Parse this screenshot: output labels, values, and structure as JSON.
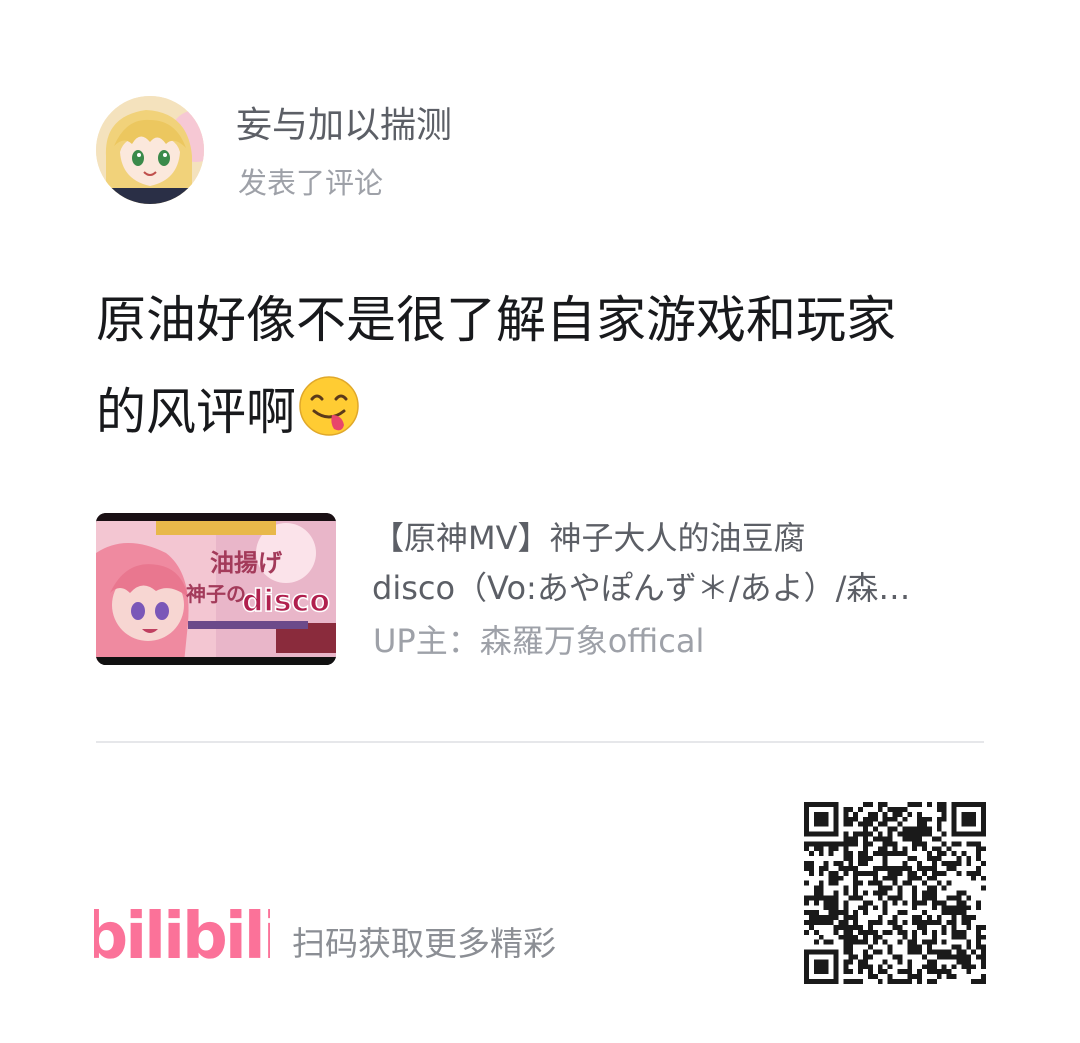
{
  "header": {
    "username": "妄与加以揣测",
    "action_text": "发表了评论"
  },
  "comment": {
    "text_line_1": "原油好像不是很了解自家游戏和玩家",
    "text_line_2": "的风评啊",
    "emoji": "yum-face-emoji"
  },
  "video": {
    "title_line_1": "【原神MV】神子大人的油豆腐",
    "title_line_2": "disco（Vo:あやぽんず＊/あよ）/森…",
    "uploader": "UP主：森羅万象offical",
    "thumbnail_text_1": "油揚げ",
    "thumbnail_text_2": "神子の",
    "thumbnail_text_3": "disco"
  },
  "footer": {
    "logo_text": "bilibili",
    "scan_text": "扫码获取更多精彩",
    "qr_icon": "qr-code-icon"
  },
  "colors": {
    "brand_pink": "#fb7299",
    "text_primary": "#18191c",
    "text_secondary": "#5c5f66",
    "text_muted": "#9ea1a8",
    "divider": "#e6e7ea"
  }
}
